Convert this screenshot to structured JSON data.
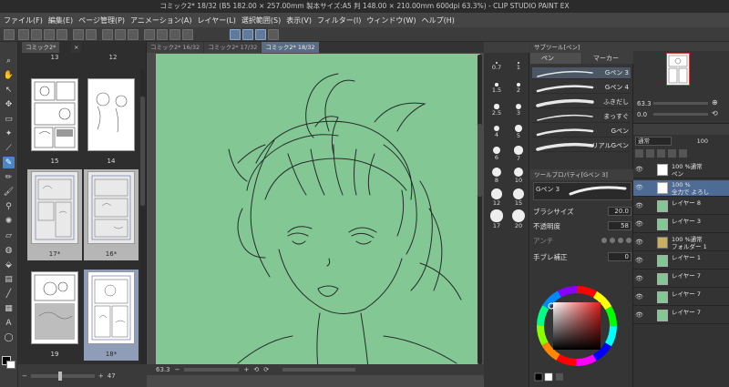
{
  "window": {
    "title": "コミック2* 18/32 (B5 182.00 × 257.00mm 製本サイズ:A5 判 148.00 × 210.00mm 600dpi 63.3%) - CLIP STUDIO PAINT EX"
  },
  "menu": [
    "ファイル(F)",
    "編集(E)",
    "ページ管理(P)",
    "アニメーション(A)",
    "レイヤー(L)",
    "選択範囲(S)",
    "表示(V)",
    "フィルター(I)",
    "ウィンドウ(W)",
    "ヘルプ(H)"
  ],
  "pages_panel": {
    "tab": "コミック2*",
    "top_labels": [
      "13",
      "12"
    ],
    "pages": [
      {
        "label": "15"
      },
      {
        "label": "14"
      },
      {
        "label": "17*"
      },
      {
        "label": "16*"
      },
      {
        "label": "19"
      },
      {
        "label": "18*"
      }
    ],
    "zoom": "47"
  },
  "doc_tabs": [
    {
      "label": "コミック2*  16/32"
    },
    {
      "label": "コミック2*  17/32"
    },
    {
      "label": "コミック2*  18/32"
    }
  ],
  "canvas_status": {
    "zoom": "63.3"
  },
  "brush_sizes": [
    "0.7",
    "1",
    "1.5",
    "2",
    "2.5",
    "3",
    "4",
    "5",
    "6",
    "7",
    "8",
    "10",
    "12",
    "15",
    "17",
    "20"
  ],
  "subtool": {
    "panel_title": "サブツール[ペン]",
    "tabs": [
      "ペン",
      "マーカー"
    ],
    "brushes": [
      "Gペン 3",
      "Gペン 4",
      "ふきだし",
      "まっすぐ",
      "Gペン",
      "リアルGペン"
    ]
  },
  "tool_property": {
    "title": "ツールプロパティ[Gペン 3]",
    "current_brush": "Gペン 3",
    "brush_size": {
      "label": "ブラシサイズ",
      "value": "20.0"
    },
    "opacity": {
      "label": "不透明度",
      "value": "58"
    },
    "antialias": {
      "label": "アンチ"
    },
    "stabilization": {
      "label": "手ブレ補正",
      "value": "0"
    }
  },
  "navigator": {
    "zoom": "63.3",
    "angle": "0.0"
  },
  "layers": {
    "blend_mode": "通常",
    "opacity": "100",
    "items": [
      {
        "line1": "100 %通常",
        "line2": "ペン",
        "thumb": "white",
        "active": false
      },
      {
        "line1": "100 %",
        "line2": "全力で よろし",
        "thumb": "white",
        "active": true
      },
      {
        "line1": "",
        "line2": "レイヤー 8",
        "thumb": "green",
        "active": false
      },
      {
        "line1": "",
        "line2": "レイヤー 3",
        "thumb": "green",
        "active": false
      },
      {
        "line1": "100 %通常",
        "line2": "フォルダー 1",
        "thumb": "folder",
        "active": false
      },
      {
        "line1": "",
        "line2": "レイヤー 1",
        "thumb": "green",
        "active": false
      },
      {
        "line1": "",
        "line2": "レイヤー 7",
        "thumb": "green",
        "active": false
      },
      {
        "line1": "",
        "line2": "レイヤー 7",
        "thumb": "green",
        "active": false
      },
      {
        "line1": "",
        "line2": "レイヤー 7",
        "thumb": "green",
        "active": false
      }
    ]
  },
  "colors": {
    "canvas_bg": "#82c794",
    "accent": "#4a86c5",
    "main_color": "#000000",
    "sub_color": "#ffffff"
  }
}
